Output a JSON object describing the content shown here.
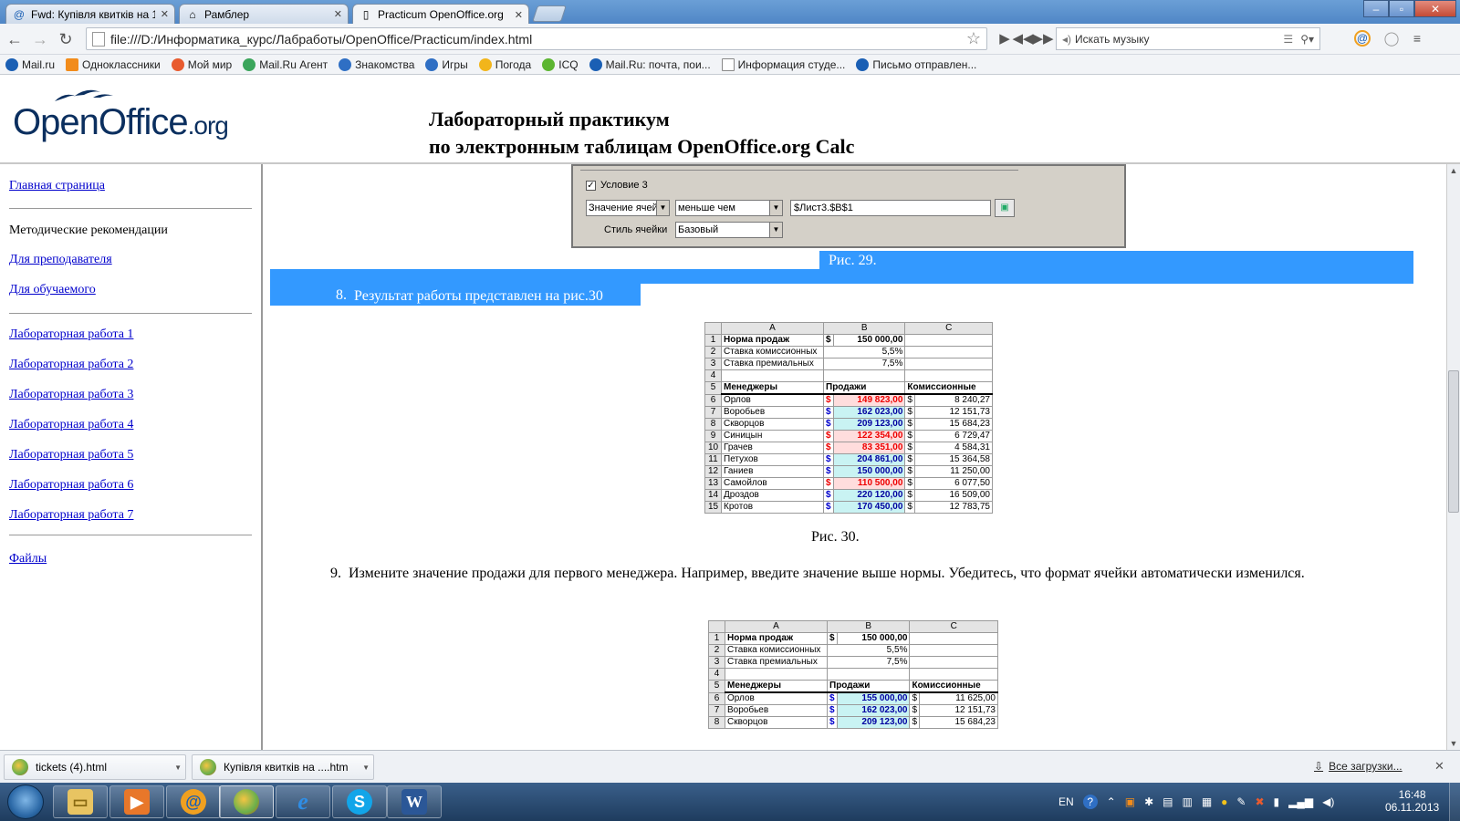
{
  "browser": {
    "tabs": [
      {
        "title": "Fwd: Купівля квитків на 1",
        "icon": "mail-icon",
        "active": false
      },
      {
        "title": "Рамблер",
        "icon": "home-icon",
        "active": false
      },
      {
        "title": "Practicum OpenOffice.org",
        "icon": "page-icon",
        "active": true
      }
    ],
    "url": "file:///D:/Информатика_курс/Лабработы/OpenOffice/Practicum/index.html",
    "music_search_placeholder": "Искать музыку",
    "bookmarks": [
      {
        "label": "Mail.ru",
        "color": "#1a5fb4"
      },
      {
        "label": "Одноклассники",
        "color": "#f28c1b"
      },
      {
        "label": "Мой мир",
        "color": "#e85b2f"
      },
      {
        "label": "Mail.Ru Агент",
        "color": "#3aa55b"
      },
      {
        "label": "Знакомства",
        "color": "#2f6fc4"
      },
      {
        "label": "Игры",
        "color": "#2f6fc4"
      },
      {
        "label": "Погода",
        "color": "#f2b51b"
      },
      {
        "label": "ICQ",
        "color": "#5cb531"
      },
      {
        "label": "Mail.Ru: почта, пои...",
        "color": "#1a5fb4"
      },
      {
        "label": "Информация студе...",
        "color": "#ffffff"
      },
      {
        "label": "Письмо отправлен...",
        "color": "#1a5fb4"
      }
    ]
  },
  "header": {
    "logo_main": "OpenOffice",
    "logo_org": ".org",
    "title_line1": "Лабораторный практикум",
    "title_line2": "по электронным таблицам OpenOffice.org Calc"
  },
  "sidebar": {
    "home": "Главная страница",
    "method_heading": "Методические рекомендации",
    "teacher": "Для преподавателя",
    "student": "Для обучаемого",
    "labs": [
      "Лабораторная работа 1",
      "Лабораторная работа 2",
      "Лабораторная работа 3",
      "Лабораторная работа 4",
      "Лабораторная работа 5",
      "Лабораторная работа 6",
      "Лабораторная работа 7"
    ],
    "files": "Файлы"
  },
  "dialog": {
    "condition_label": "Условие 3",
    "cell_value": "Значение ячей",
    "operator": "меньше чем",
    "ref_value": "$Лист3.$B$1",
    "style_label": "Стиль ячейки",
    "style_value": "Базовый"
  },
  "content": {
    "fig29": "Рис. 29.",
    "item8_num": "8.",
    "item8_text": "Результат работы представлен на рис.30",
    "fig30": "Рис. 30.",
    "item9_num": "9.",
    "item9_text": "Измените значение продажи для первого менеджера. Например, введите значение выше нормы. Убедитесь, что формат ячейки автоматически изменился."
  },
  "sheet1": {
    "cols": [
      "A",
      "B",
      "C"
    ],
    "norm_label": "Норма продаж",
    "norm_value": "150 000,00",
    "rate1_label": "Ставка комиссионных",
    "rate1_value": "5,5%",
    "rate2_label": "Ставка премиальных",
    "rate2_value": "7,5%",
    "h_managers": "Менеджеры",
    "h_sales": "Продажи",
    "h_comm": "Комиссионные",
    "currency": "$",
    "rows": [
      {
        "n": "6",
        "name": "Орлов",
        "sale": "149 823,00",
        "comm": "8 240,27",
        "low": true
      },
      {
        "n": "7",
        "name": "Воробьев",
        "sale": "162 023,00",
        "comm": "12 151,73",
        "low": false
      },
      {
        "n": "8",
        "name": "Скворцов",
        "sale": "209 123,00",
        "comm": "15 684,23",
        "low": false
      },
      {
        "n": "9",
        "name": "Синицын",
        "sale": "122 354,00",
        "comm": "6 729,47",
        "low": true
      },
      {
        "n": "10",
        "name": "Грачев",
        "sale": "83 351,00",
        "comm": "4 584,31",
        "low": true
      },
      {
        "n": "11",
        "name": "Петухов",
        "sale": "204 861,00",
        "comm": "15 364,58",
        "low": false
      },
      {
        "n": "12",
        "name": "Ганиев",
        "sale": "150 000,00",
        "comm": "11 250,00",
        "low": false
      },
      {
        "n": "13",
        "name": "Самойлов",
        "sale": "110 500,00",
        "comm": "6 077,50",
        "low": true
      },
      {
        "n": "14",
        "name": "Дроздов",
        "sale": "220 120,00",
        "comm": "16 509,00",
        "low": false
      },
      {
        "n": "15",
        "name": "Кротов",
        "sale": "170 450,00",
        "comm": "12 783,75",
        "low": false
      }
    ]
  },
  "sheet2": {
    "norm_value": "150 000,00",
    "rate1_value": "5,5%",
    "rate2_value": "7,5%",
    "rows": [
      {
        "n": "6",
        "name": "Орлов",
        "sale": "155 000,00",
        "comm": "11 625,00",
        "low": false
      },
      {
        "n": "7",
        "name": "Воробьев",
        "sale": "162 023,00",
        "comm": "12 151,73",
        "low": false
      },
      {
        "n": "8",
        "name": "Скворцов",
        "sale": "209 123,00",
        "comm": "15 684,23",
        "low": false
      }
    ]
  },
  "downloads": {
    "items": [
      "tickets (4).html",
      "Купівля квитків на ....htm"
    ],
    "all_label": "Все загрузки..."
  },
  "taskbar": {
    "lang": "EN",
    "time": "16:48",
    "date": "06.11.2013"
  }
}
